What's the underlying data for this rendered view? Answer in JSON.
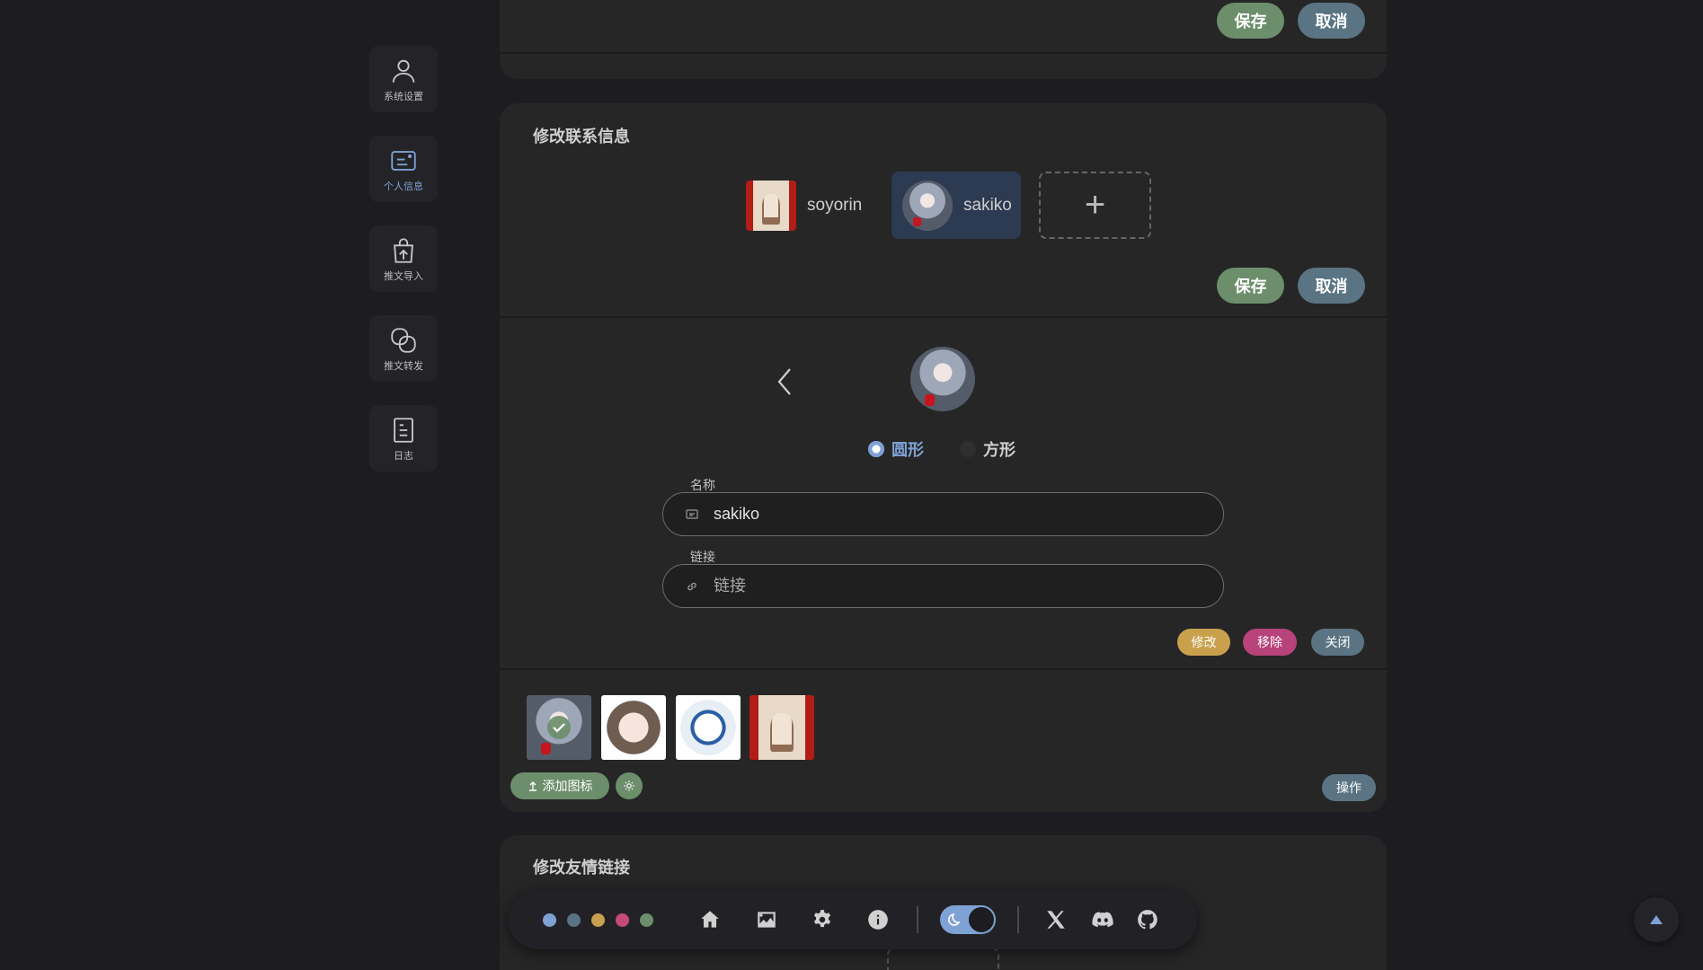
{
  "sidebar": {
    "items": [
      {
        "label": "系统设置",
        "icon": "user-icon"
      },
      {
        "label": "个人信息",
        "icon": "id-card-icon"
      },
      {
        "label": "推文导入",
        "icon": "bag-upload-icon"
      },
      {
        "label": "推文转发",
        "icon": "repost-icon"
      },
      {
        "label": "日志",
        "icon": "document-icon"
      }
    ],
    "active_index": 1
  },
  "top_panel": {
    "save_label": "保存",
    "cancel_label": "取消"
  },
  "contact_panel": {
    "title": "修改联系信息",
    "contacts": [
      {
        "name": "soyorin",
        "avatar": "room-art"
      },
      {
        "name": "sakiko",
        "avatar": "girl-art"
      }
    ],
    "add_label": "+",
    "save_label": "保存",
    "cancel_label": "取消"
  },
  "editor": {
    "shape_options": [
      {
        "label": "圆形",
        "selected": true
      },
      {
        "label": "方形",
        "selected": false
      }
    ],
    "name_label": "名称",
    "name_value": "sakiko",
    "link_label": "链接",
    "link_placeholder": "链接",
    "modify_label": "修改",
    "remove_label": "移除",
    "close_label": "关闭"
  },
  "icon_library": {
    "add_icon_label": "添加图标",
    "operations_label": "操作"
  },
  "friends_panel": {
    "title": "修改友情链接"
  },
  "toolbar": {
    "theme_colors": [
      "#7fa2d6",
      "#5a7484",
      "#c9a04c",
      "#c64a78",
      "#6c8e6b"
    ]
  },
  "colors": {
    "accent": "#7fa2d6",
    "save": "#6c8e6b",
    "cancel": "#5a7484",
    "modify": "#c9a04c",
    "remove": "#b8427a",
    "close": "#5a7484"
  }
}
